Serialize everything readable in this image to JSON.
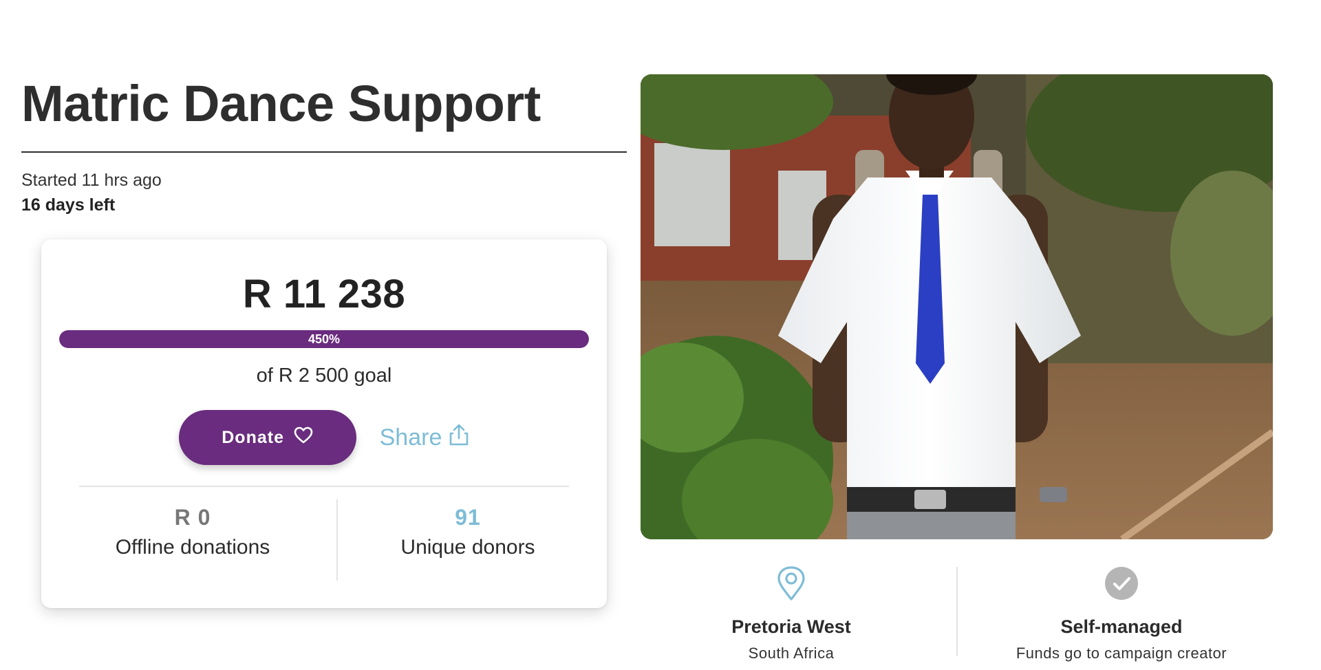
{
  "campaign": {
    "title": "Matric Dance Support",
    "started": "Started 11 hrs ago",
    "days_left": "16 days left"
  },
  "card": {
    "amount_raised": "R 11 238",
    "progress_percent": 450,
    "progress_label": "450%",
    "goal_text": "of R 2 500 goal",
    "donate_label": "Donate",
    "share_label": "Share",
    "offline_value": "R 0",
    "offline_label": "Offline donations",
    "donors_value": "91",
    "donors_label": "Unique donors"
  },
  "info": {
    "location_title": "Pretoria West",
    "location_sub": "South Africa",
    "managed_title": "Self-managed",
    "managed_sub": "Funds go to campaign creator"
  },
  "colors": {
    "brand_purple": "#6a2c7e",
    "accent_blue": "#7dbcd6",
    "check_gray": "#b5b5b5"
  },
  "icons": {
    "donate": "heart-icon",
    "share": "share-icon",
    "location": "map-pin-icon",
    "managed": "check-circle-icon"
  }
}
